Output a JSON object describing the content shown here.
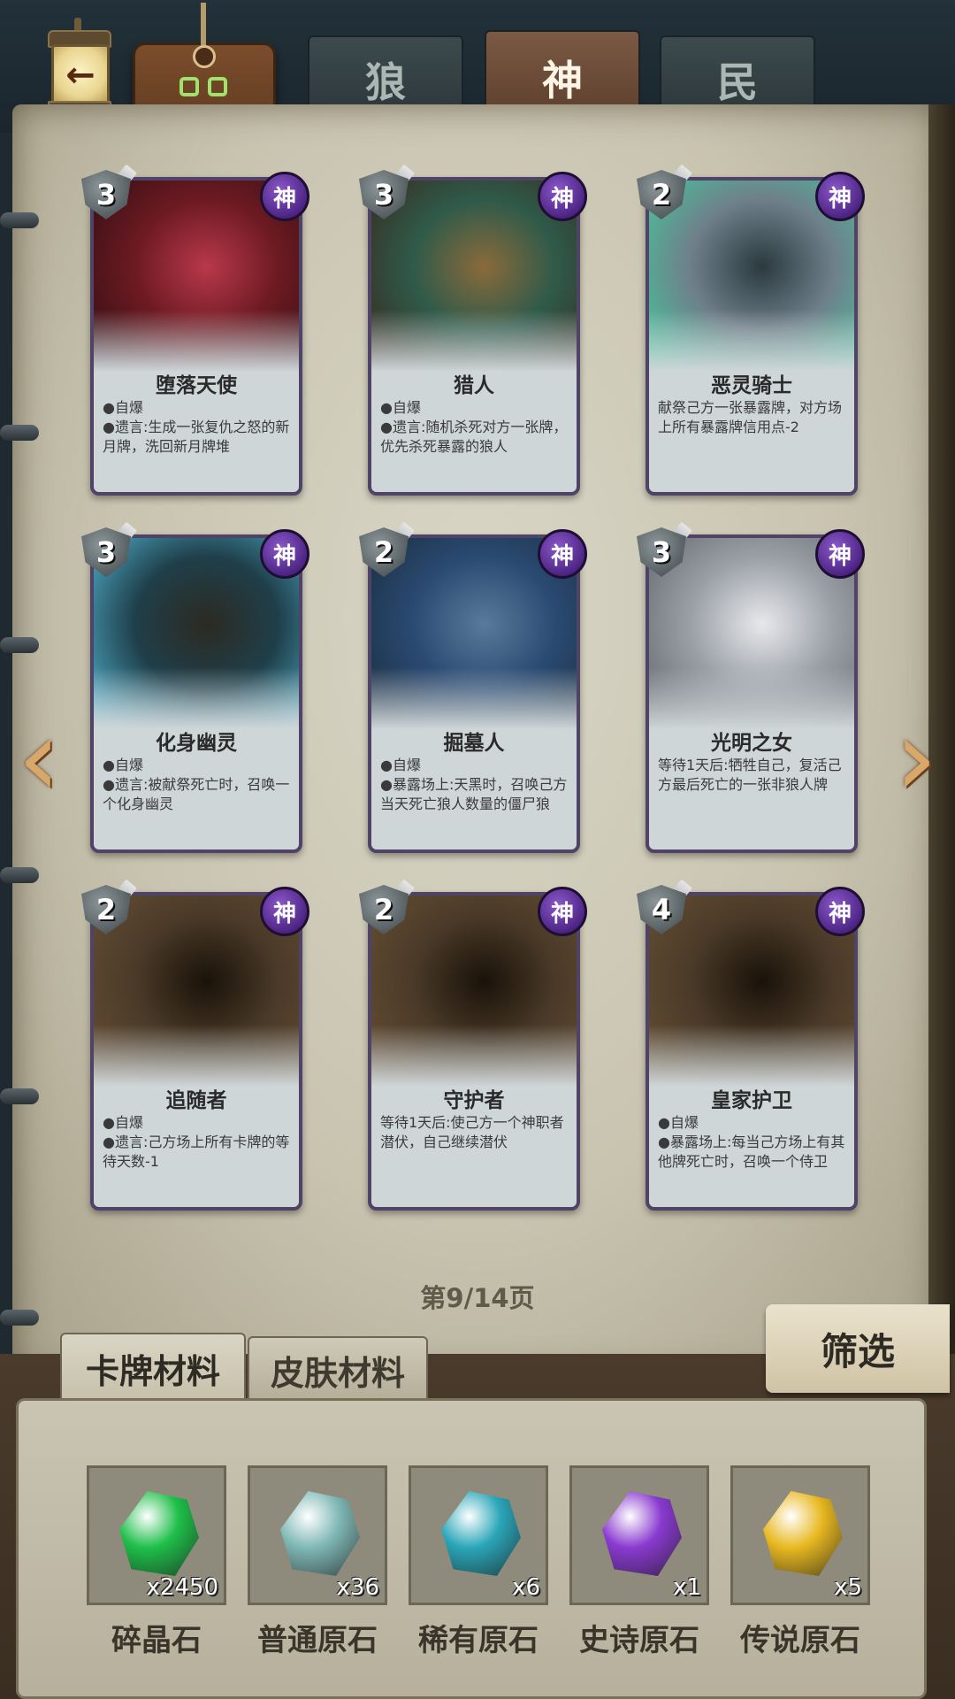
{
  "header": {
    "back_icon_glyph": "←",
    "tabs": [
      {
        "label": "狼",
        "active": false
      },
      {
        "label": "神",
        "active": true
      },
      {
        "label": "民",
        "active": false
      }
    ]
  },
  "cards": [
    {
      "cost": "3",
      "faction": "神",
      "name": "堕落天使",
      "lines": [
        {
          "text": "●自爆"
        },
        {
          "text": "●遗言:生成一张复仇之怒的新月牌，洗回新月牌堆"
        }
      ],
      "art": [
        "#6d1a22",
        "#b8384a",
        "#2a0d12"
      ]
    },
    {
      "cost": "3",
      "faction": "神",
      "name": "猎人",
      "lines": [
        {
          "text": "●自爆"
        },
        {
          "text": "●遗言:随机杀死对方一张牌，优先杀死暴露的狼人"
        }
      ],
      "art": [
        "#2f5a4a",
        "#8a6a3a",
        "#3a2418"
      ]
    },
    {
      "cost": "2",
      "faction": "神",
      "name": "恶灵骑士",
      "lines": [
        {
          "text": "献祭己方一张暴露牌，对方场上所有暴露牌信用点-2"
        }
      ],
      "art": [
        "#6f7f8a",
        "#2a3a3f",
        "#3fd0a0"
      ]
    },
    {
      "cost": "3",
      "faction": "神",
      "name": "化身幽灵",
      "lines": [
        {
          "text": "●自爆"
        },
        {
          "text": "●遗言:被献祭死亡时，召唤一个化身幽灵"
        }
      ],
      "art": [
        "#1f3f4a",
        "#2c2a22",
        "#58c0e0"
      ]
    },
    {
      "cost": "2",
      "faction": "神",
      "name": "掘墓人",
      "lines": [
        {
          "text": "●自爆"
        },
        {
          "text": "●暴露场上:天黑时，召唤己方当天死亡狼人数量的僵尸狼"
        }
      ],
      "art": [
        "#2a4a72",
        "#5a7a9a",
        "#1a2a3a"
      ]
    },
    {
      "cost": "3",
      "faction": "神",
      "name": "光明之女",
      "lines": [
        {
          "text": "等待1天后:牺牲自己，复活己方最后死亡的一张非狼人牌"
        }
      ],
      "art": [
        "#9aa0a6",
        "#e8e8ec",
        "#5c6066"
      ]
    },
    {
      "cost": "2",
      "faction": "神",
      "name": "追随者",
      "lines": [
        {
          "text": "●自爆"
        },
        {
          "text": "●遗言:己方场上所有卡牌的等待天数-1"
        }
      ],
      "art": [
        "#4a3a28",
        "#1a120a",
        "#6a5236"
      ]
    },
    {
      "cost": "2",
      "faction": "神",
      "name": "守护者",
      "lines": [
        {
          "text": "等待1天后:使己方一个神职者潜伏，自己继续潜伏"
        }
      ],
      "art": [
        "#4a3a28",
        "#1a120a",
        "#6a5236"
      ]
    },
    {
      "cost": "4",
      "faction": "神",
      "name": "皇家护卫",
      "lines": [
        {
          "text": "●自爆"
        },
        {
          "text": "●暴露场上:每当己方场上有其他牌死亡时，召唤一个侍卫"
        }
      ],
      "art": [
        "#4a3a28",
        "#1a120a",
        "#6a5236"
      ]
    }
  ],
  "page_indicator": "第9/14页",
  "materials": {
    "tabs": [
      {
        "label": "卡牌材料",
        "active": true
      },
      {
        "label": "皮肤材料",
        "active": false
      }
    ],
    "filter_label": "筛选",
    "items": [
      {
        "name": "碎晶石",
        "count": "x2450",
        "color": "#1fbf4a",
        "icon": "green-crystal-icon"
      },
      {
        "name": "普通原石",
        "count": "x36",
        "color": "#7fb8b6",
        "icon": "pale-stone-icon"
      },
      {
        "name": "稀有原石",
        "count": "x6",
        "color": "#2aa6b8",
        "icon": "teal-stone-icon"
      },
      {
        "name": "史诗原石",
        "count": "x1",
        "color": "#8a3ad0",
        "icon": "purple-stone-icon"
      },
      {
        "name": "传说原石",
        "count": "x5",
        "color": "#e8b820",
        "icon": "gold-stone-icon"
      }
    ]
  }
}
